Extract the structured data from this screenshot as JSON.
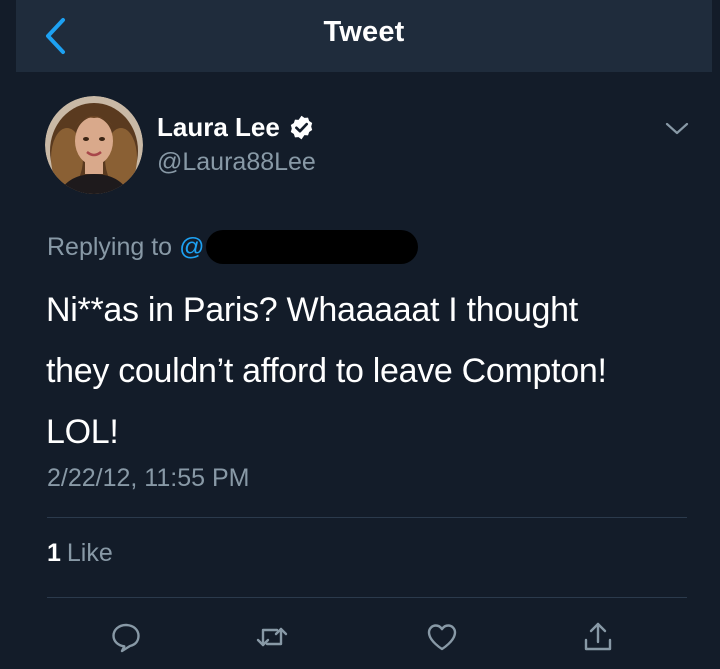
{
  "header": {
    "title": "Tweet",
    "back_icon": "chevron-left-icon",
    "accent_color": "#1da1f2"
  },
  "tweet": {
    "author": {
      "display_name": "Laura Lee",
      "handle": "@Laura88Lee",
      "verified": true
    },
    "replying_prefix": "Replying to",
    "replying_at": "@",
    "text_lines": [
      "Ni**as in Paris? Whaaaaat I thought",
      "they couldn’t afford to leave Compton!",
      "LOL!"
    ],
    "timestamp": "2/22/12, 11:55 PM",
    "likes": {
      "count": "1",
      "label": "Like"
    },
    "actions": [
      "reply-icon",
      "retweet-icon",
      "heart-icon",
      "share-icon"
    ]
  }
}
